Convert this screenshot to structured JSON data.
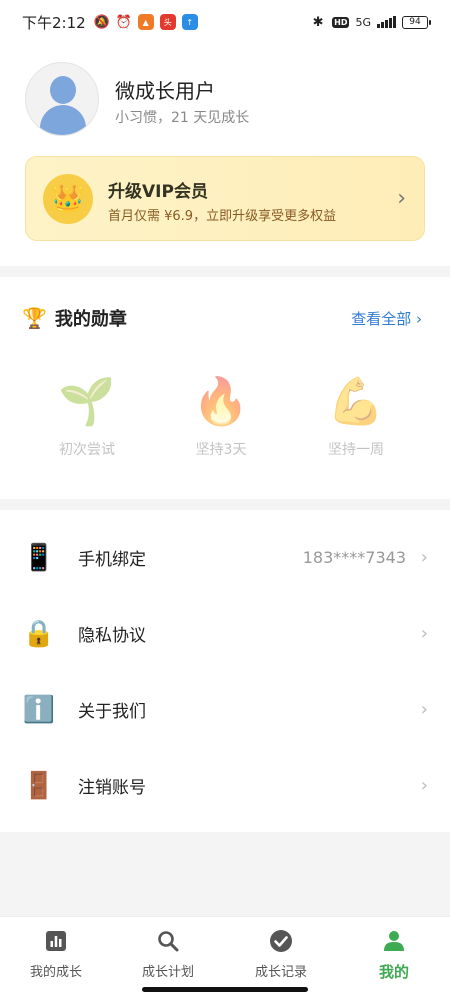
{
  "status_bar": {
    "time": "下午2:12",
    "network": "5G",
    "battery": "94",
    "hd": "HD"
  },
  "profile": {
    "name": "微成长用户",
    "subtitle": "小习惯，21 天见成长"
  },
  "vip": {
    "title": "升级VIP会员",
    "subtitle": "首月仅需 ¥6.9，立即升级享受更多权益"
  },
  "badges": {
    "title": "我的勋章",
    "view_all": "查看全部 ›",
    "items": [
      {
        "label": "初次尝试",
        "icon": "seedling-icon"
      },
      {
        "label": "坚持3天",
        "icon": "fire-icon"
      },
      {
        "label": "坚持一周",
        "icon": "flexed-biceps-icon"
      }
    ]
  },
  "menu": {
    "items": [
      {
        "label": "手机绑定",
        "value": "183****7343",
        "icon": "mobile-phone-icon"
      },
      {
        "label": "隐私协议",
        "value": "",
        "icon": "lock-icon"
      },
      {
        "label": "关于我们",
        "value": "",
        "icon": "info-icon"
      },
      {
        "label": "注销账号",
        "value": "",
        "icon": "door-icon"
      }
    ]
  },
  "tabs": [
    {
      "label": "我的成长",
      "icon": "bar-chart-icon"
    },
    {
      "label": "成长计划",
      "icon": "search-icon"
    },
    {
      "label": "成长记录",
      "icon": "check-circle-icon"
    },
    {
      "label": "我的",
      "icon": "person-icon",
      "active": true
    }
  ],
  "colors": {
    "accent": "#3eaa52",
    "link": "#2e7bd4",
    "vip_gradient_start": "#fdf3c7",
    "vip_gradient_end": "#ffedb8"
  }
}
